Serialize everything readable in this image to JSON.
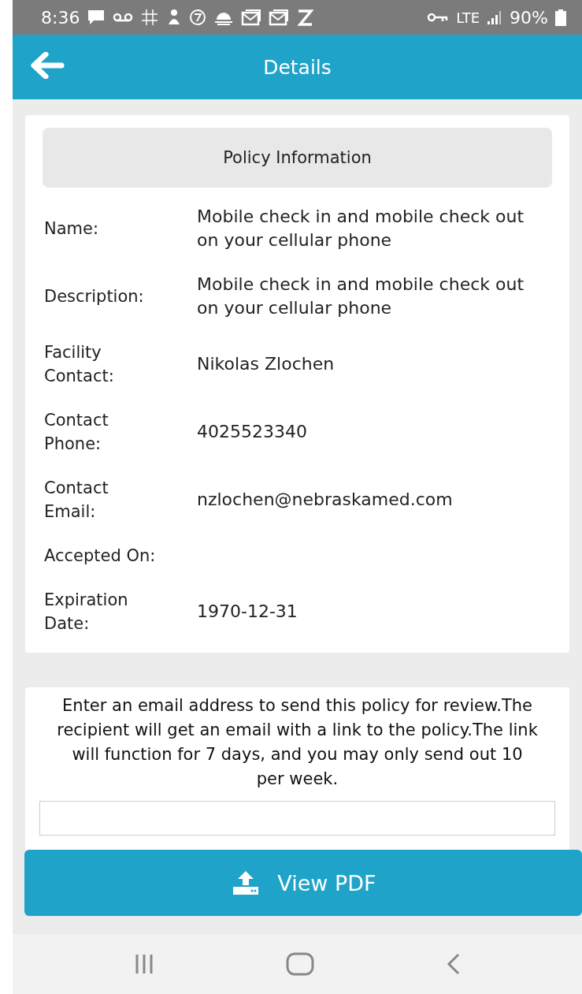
{
  "status_bar": {
    "time": "8:36",
    "network": "LTE",
    "battery": "90%"
  },
  "app_bar": {
    "title": "Details"
  },
  "policy": {
    "heading": "Policy Information",
    "fields": [
      {
        "label": "Name:",
        "value": "Mobile check in and mobile check out on your cellular phone"
      },
      {
        "label": "Description:",
        "value": "Mobile check in and mobile check out on your cellular phone"
      },
      {
        "label": "Facility Contact:",
        "value": "Nikolas Zlochen"
      },
      {
        "label": "Contact Phone:",
        "value": "4025523340"
      },
      {
        "label": "Contact Email:",
        "value": "nzlochen@nebraskamed.com"
      },
      {
        "label": "Accepted On:"
      },
      {
        "label": "Expiration Date:",
        "value": "1970-12-31"
      }
    ]
  },
  "share": {
    "instructions": "Enter an email address to send this policy for review.The recipient will get an email with a link to the policy.The link will function for 7 days, and you may only send out 10 per week."
  },
  "view_pdf_button": {
    "label": "View PDF"
  }
}
